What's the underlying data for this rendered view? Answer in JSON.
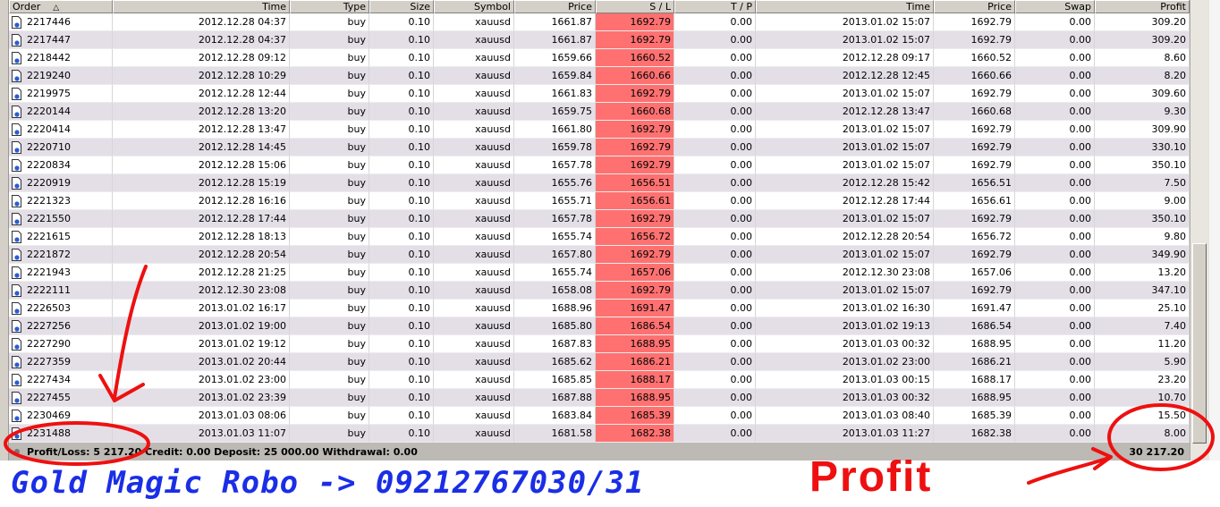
{
  "columns": [
    "Order",
    "Time",
    "Type",
    "Size",
    "Symbol",
    "Price",
    "S / L",
    "T / P",
    "Time",
    "Price",
    "Swap",
    "Profit"
  ],
  "sort_indicator": "△",
  "rows": [
    [
      "2217446",
      "2012.12.28 04:37",
      "buy",
      "0.10",
      "xauusd",
      "1661.87",
      "1692.79",
      "0.00",
      "2013.01.02 15:07",
      "1692.79",
      "0.00",
      "309.20"
    ],
    [
      "2217447",
      "2012.12.28 04:37",
      "buy",
      "0.10",
      "xauusd",
      "1661.87",
      "1692.79",
      "0.00",
      "2013.01.02 15:07",
      "1692.79",
      "0.00",
      "309.20"
    ],
    [
      "2218442",
      "2012.12.28 09:12",
      "buy",
      "0.10",
      "xauusd",
      "1659.66",
      "1660.52",
      "0.00",
      "2012.12.28 09:17",
      "1660.52",
      "0.00",
      "8.60"
    ],
    [
      "2219240",
      "2012.12.28 10:29",
      "buy",
      "0.10",
      "xauusd",
      "1659.84",
      "1660.66",
      "0.00",
      "2012.12.28 12:45",
      "1660.66",
      "0.00",
      "8.20"
    ],
    [
      "2219975",
      "2012.12.28 12:44",
      "buy",
      "0.10",
      "xauusd",
      "1661.83",
      "1692.79",
      "0.00",
      "2013.01.02 15:07",
      "1692.79",
      "0.00",
      "309.60"
    ],
    [
      "2220144",
      "2012.12.28 13:20",
      "buy",
      "0.10",
      "xauusd",
      "1659.75",
      "1660.68",
      "0.00",
      "2012.12.28 13:47",
      "1660.68",
      "0.00",
      "9.30"
    ],
    [
      "2220414",
      "2012.12.28 13:47",
      "buy",
      "0.10",
      "xauusd",
      "1661.80",
      "1692.79",
      "0.00",
      "2013.01.02 15:07",
      "1692.79",
      "0.00",
      "309.90"
    ],
    [
      "2220710",
      "2012.12.28 14:45",
      "buy",
      "0.10",
      "xauusd",
      "1659.78",
      "1692.79",
      "0.00",
      "2013.01.02 15:07",
      "1692.79",
      "0.00",
      "330.10"
    ],
    [
      "2220834",
      "2012.12.28 15:06",
      "buy",
      "0.10",
      "xauusd",
      "1657.78",
      "1692.79",
      "0.00",
      "2013.01.02 15:07",
      "1692.79",
      "0.00",
      "350.10"
    ],
    [
      "2220919",
      "2012.12.28 15:19",
      "buy",
      "0.10",
      "xauusd",
      "1655.76",
      "1656.51",
      "0.00",
      "2012.12.28 15:42",
      "1656.51",
      "0.00",
      "7.50"
    ],
    [
      "2221323",
      "2012.12.28 16:16",
      "buy",
      "0.10",
      "xauusd",
      "1655.71",
      "1656.61",
      "0.00",
      "2012.12.28 17:44",
      "1656.61",
      "0.00",
      "9.00"
    ],
    [
      "2221550",
      "2012.12.28 17:44",
      "buy",
      "0.10",
      "xauusd",
      "1657.78",
      "1692.79",
      "0.00",
      "2013.01.02 15:07",
      "1692.79",
      "0.00",
      "350.10"
    ],
    [
      "2221615",
      "2012.12.28 18:13",
      "buy",
      "0.10",
      "xauusd",
      "1655.74",
      "1656.72",
      "0.00",
      "2012.12.28 20:54",
      "1656.72",
      "0.00",
      "9.80"
    ],
    [
      "2221872",
      "2012.12.28 20:54",
      "buy",
      "0.10",
      "xauusd",
      "1657.80",
      "1692.79",
      "0.00",
      "2013.01.02 15:07",
      "1692.79",
      "0.00",
      "349.90"
    ],
    [
      "2221943",
      "2012.12.28 21:25",
      "buy",
      "0.10",
      "xauusd",
      "1655.74",
      "1657.06",
      "0.00",
      "2012.12.30 23:08",
      "1657.06",
      "0.00",
      "13.20"
    ],
    [
      "2222111",
      "2012.12.30 23:08",
      "buy",
      "0.10",
      "xauusd",
      "1658.08",
      "1692.79",
      "0.00",
      "2013.01.02 15:07",
      "1692.79",
      "0.00",
      "347.10"
    ],
    [
      "2226503",
      "2013.01.02 16:17",
      "buy",
      "0.10",
      "xauusd",
      "1688.96",
      "1691.47",
      "0.00",
      "2013.01.02 16:30",
      "1691.47",
      "0.00",
      "25.10"
    ],
    [
      "2227256",
      "2013.01.02 19:00",
      "buy",
      "0.10",
      "xauusd",
      "1685.80",
      "1686.54",
      "0.00",
      "2013.01.02 19:13",
      "1686.54",
      "0.00",
      "7.40"
    ],
    [
      "2227290",
      "2013.01.02 19:12",
      "buy",
      "0.10",
      "xauusd",
      "1687.83",
      "1688.95",
      "0.00",
      "2013.01.03 00:32",
      "1688.95",
      "0.00",
      "11.20"
    ],
    [
      "2227359",
      "2013.01.02 20:44",
      "buy",
      "0.10",
      "xauusd",
      "1685.62",
      "1686.21",
      "0.00",
      "2013.01.02 23:00",
      "1686.21",
      "0.00",
      "5.90"
    ],
    [
      "2227434",
      "2013.01.02 23:00",
      "buy",
      "0.10",
      "xauusd",
      "1685.85",
      "1688.17",
      "0.00",
      "2013.01.03 00:15",
      "1688.17",
      "0.00",
      "23.20"
    ],
    [
      "2227455",
      "2013.01.02 23:39",
      "buy",
      "0.10",
      "xauusd",
      "1687.88",
      "1688.95",
      "0.00",
      "2013.01.03 00:32",
      "1688.95",
      "0.00",
      "10.70"
    ],
    [
      "2230469",
      "2013.01.03 08:06",
      "buy",
      "0.10",
      "xauusd",
      "1683.84",
      "1685.39",
      "0.00",
      "2013.01.03 08:40",
      "1685.39",
      "0.00",
      "15.50"
    ],
    [
      "2231488",
      "2013.01.03 11:07",
      "buy",
      "0.10",
      "xauusd",
      "1681.58",
      "1682.38",
      "0.00",
      "2013.01.03 11:27",
      "1682.38",
      "0.00",
      "8.00"
    ]
  ],
  "summary": {
    "text": "Profit/Loss: 5 217.20  Credit: 0.00  Deposit: 25 000.00  Withdrawal: 0.00",
    "total": "30 217.20"
  },
  "annotations": {
    "caption": "Gold Magic Robo -> 09212767030/31",
    "profit_label": "Profit",
    "ink_color": "#ee1010",
    "caption_color": "#1a2ee6"
  },
  "colors": {
    "sl_cell": "#ff7171",
    "alt_row": "#e4dfe7"
  }
}
